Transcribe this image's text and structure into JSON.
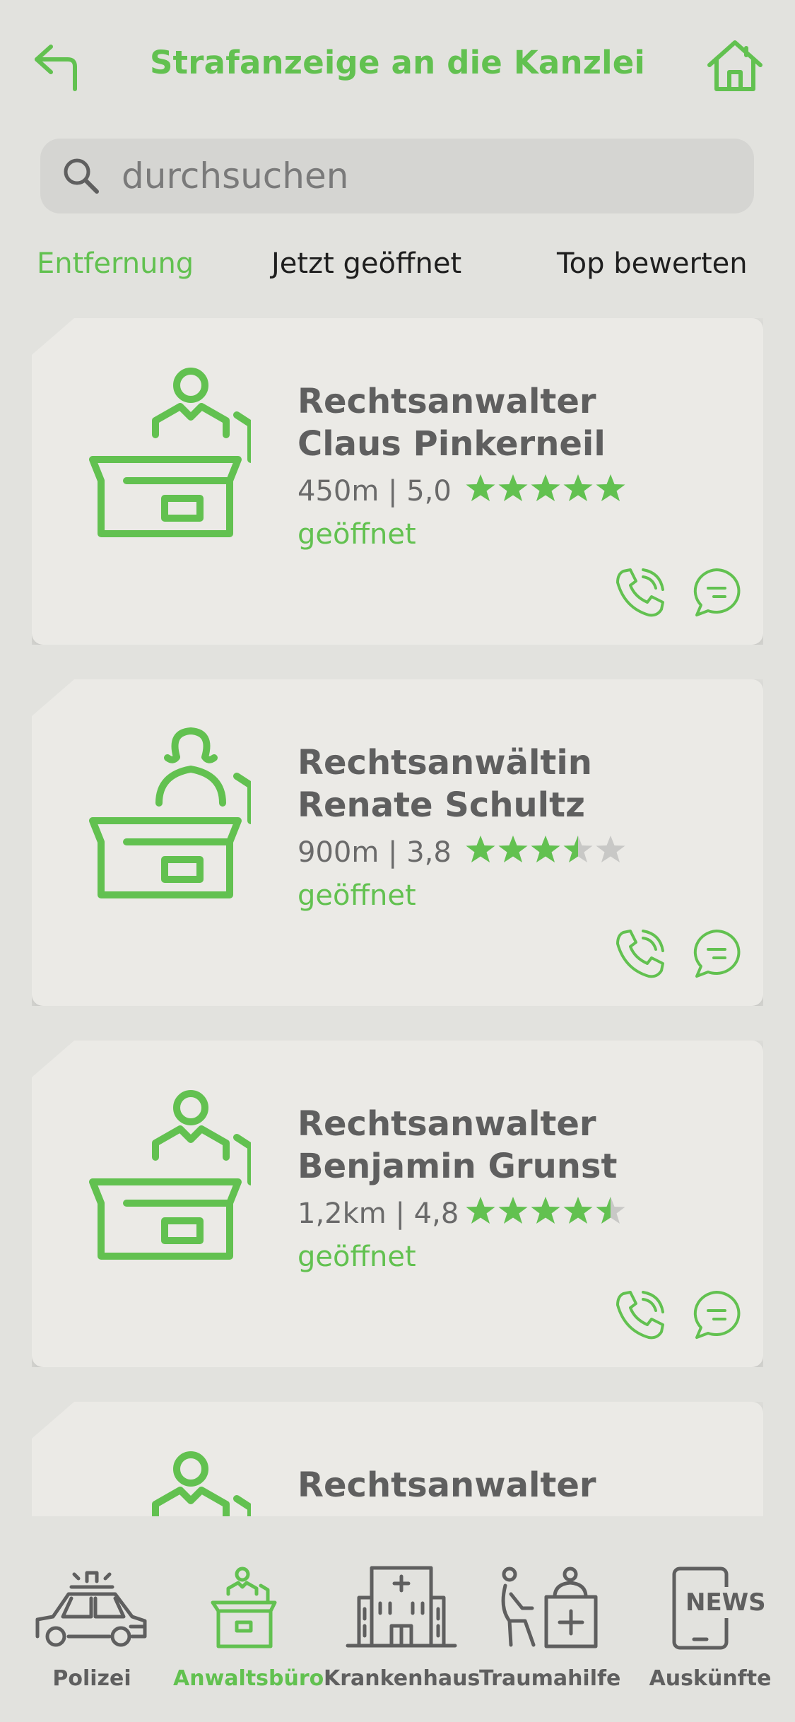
{
  "header": {
    "title": "Strafanzeige an die Kanzlei",
    "back_icon": "back-arrow-icon",
    "home_icon": "home-icon"
  },
  "search": {
    "placeholder": "durchsuchen",
    "icon": "search-icon"
  },
  "filters": [
    {
      "label": "Entfernung",
      "active": true
    },
    {
      "label": "Jetzt geöffnet",
      "active": false
    },
    {
      "label": "Top bewerten",
      "active": false
    }
  ],
  "results": [
    {
      "title_line1": "Rechtsanwalter",
      "title_line2": "Claus Pinkerneil",
      "meta": "450m | 5,0",
      "rating": 5.0,
      "status": "geöffnet",
      "icon": "lawyer-male-icon"
    },
    {
      "title_line1": "Rechtsanwältin",
      "title_line2": "Renate Schultz",
      "meta": "900m | 3,8",
      "rating": 3.8,
      "status": "geöffnet",
      "icon": "lawyer-female-icon"
    },
    {
      "title_line1": "Rechtsanwalter",
      "title_line2": "Benjamin Grunst",
      "meta": "1,2km | 4,8",
      "rating": 4.8,
      "status": "geöffnet",
      "icon": "lawyer-male-icon"
    },
    {
      "title_line1": "Rechtsanwalter",
      "title_line2": "",
      "meta": "",
      "rating": null,
      "status": "",
      "icon": "lawyer-male-icon"
    }
  ],
  "colors": {
    "accent": "#62c150",
    "background": "#e2e2de",
    "card": "#ebeae6",
    "text": "#5f5f5f",
    "star_empty": "#c8c8c6"
  },
  "tabbar": [
    {
      "label": "Polizei",
      "icon": "police-car-icon",
      "active": false
    },
    {
      "label": "Anwaltsbüro",
      "icon": "lawyer-desk-icon",
      "active": true
    },
    {
      "label": "Krankenhaus",
      "icon": "hospital-icon",
      "active": false
    },
    {
      "label": "Traumahilfe",
      "icon": "trauma-help-icon",
      "active": false
    },
    {
      "label": "Auskünfte",
      "icon": "news-icon",
      "active": false
    }
  ],
  "tabbar_news_text": "NEWS"
}
